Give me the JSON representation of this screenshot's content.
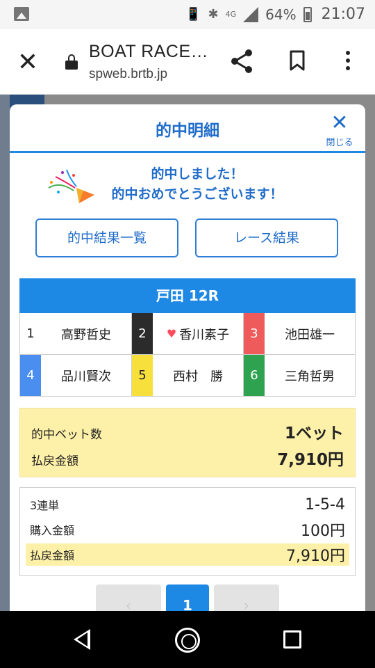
{
  "status_bar": {
    "network": "4G",
    "battery_percent": "64%",
    "time": "21:07"
  },
  "browser": {
    "title": "BOAT RACE…",
    "url": "spweb.brtb.jp"
  },
  "modal": {
    "title": "的中明細",
    "close_label": "閉じる",
    "congrats_line1": "的中しました！",
    "congrats_line2": "的中おめでとうございます！",
    "buttons": {
      "hit_list": "的中結果一覧",
      "race_results": "レース結果"
    },
    "race": {
      "header": "戸田 12R",
      "racers": [
        {
          "lane": "1",
          "name": "高野哲史",
          "lane_bg": "#ffffff",
          "lane_fg": "#222222",
          "favorite": false
        },
        {
          "lane": "2",
          "name": "香川素子",
          "lane_bg": "#2b2b2b",
          "lane_fg": "#ffffff",
          "favorite": true
        },
        {
          "lane": "3",
          "name": "池田雄一",
          "lane_bg": "#ef5b5b",
          "lane_fg": "#ffffff",
          "favorite": false
        },
        {
          "lane": "4",
          "name": "品川賢次",
          "lane_bg": "#4a8ef0",
          "lane_fg": "#ffffff",
          "favorite": false
        },
        {
          "lane": "5",
          "name": "西村　勝",
          "lane_bg": "#f7df3c",
          "lane_fg": "#222222",
          "favorite": false
        },
        {
          "lane": "6",
          "name": "三角哲男",
          "lane_bg": "#2fa24f",
          "lane_fg": "#ffffff",
          "favorite": false
        }
      ]
    },
    "summary": {
      "bets_label": "的中ベット数",
      "bets_value": "1ベット",
      "payout_label": "払戻金額",
      "payout_value": "7,910円"
    },
    "detail": {
      "type_label": "3連単",
      "type_value": "1-5-4",
      "purchase_label": "購入金額",
      "purchase_value": "100円",
      "payout_label": "払戻金額",
      "payout_value": "7,910円"
    },
    "pager": {
      "current": "1",
      "prev_glyph": "‹",
      "next_glyph": "›"
    }
  },
  "colors": {
    "accent": "#1e88e5",
    "highlight": "#fdf0a8"
  }
}
